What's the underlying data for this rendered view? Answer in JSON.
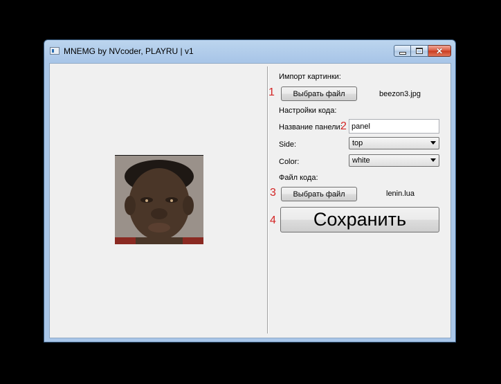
{
  "window": {
    "title": "MNEMG by NVcoder, PLAYRU | v1",
    "buttons": {
      "minimize": "minimize",
      "maximize": "maximize",
      "close": "close"
    }
  },
  "preview": {
    "image_description_icon": "photo-preview"
  },
  "form": {
    "import_label": "Импорт картинки:",
    "marker_1": "1",
    "choose_image_button": "Выбрать файл",
    "image_file": "beezon3.jpg",
    "code_settings_label": "Настройки кода:",
    "panel_name_label": "Название панели:",
    "marker_2": "2",
    "panel_name_value": "panel",
    "side_label": "Side:",
    "side_value": "top",
    "color_label": "Color:",
    "color_value": "white",
    "code_file_label": "Файл кода:",
    "marker_3": "3",
    "choose_code_button": "Выбрать файл",
    "code_file": "lenin.lua",
    "marker_4": "4",
    "save_button": "Сохранить"
  },
  "colors": {
    "marker": "#d32424",
    "titlebar": "#a9c6e8",
    "client": "#f0f0f0"
  }
}
